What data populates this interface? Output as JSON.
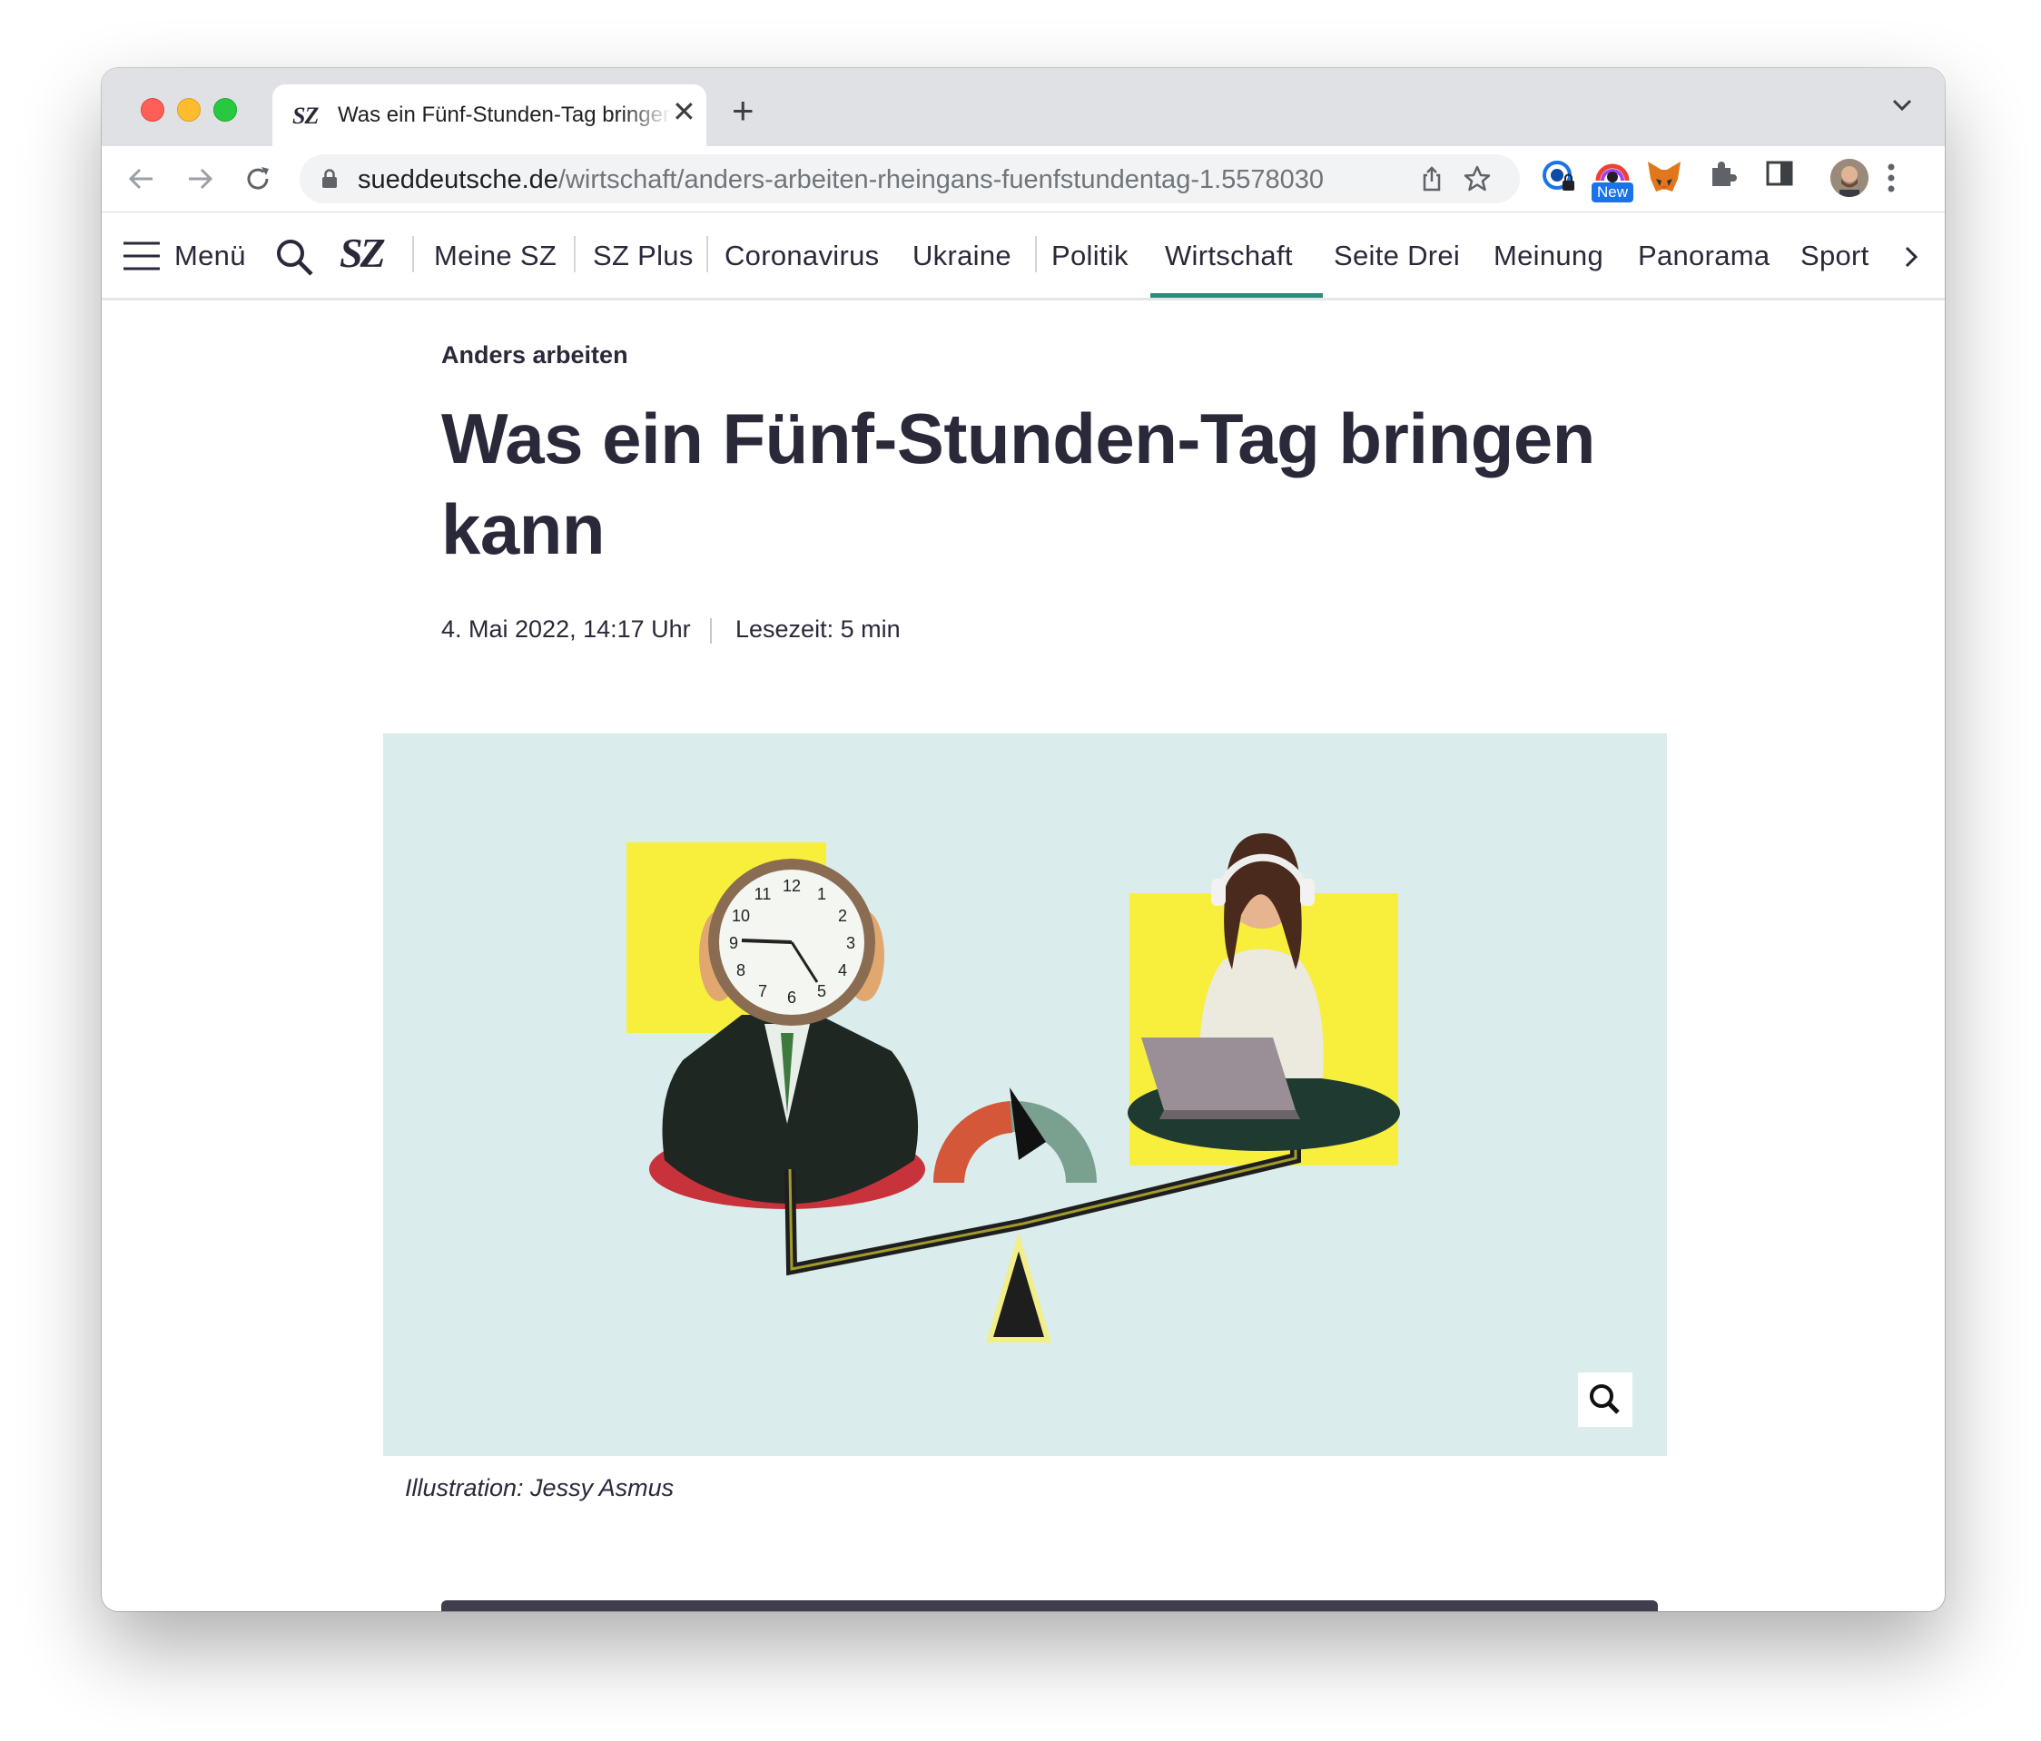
{
  "browser": {
    "tab": {
      "favicon_text": "SZ",
      "title": "Was ein Fünf-Stunden-Tag bringen kann",
      "close_symbol": "✕"
    },
    "new_tab_symbol": "+",
    "url_host": "sueddeutsche.de",
    "url_path": "/wirtschaft/anders-arbeiten-rheingans-fuenfstundentag-1.5578030",
    "extension_badge": "New",
    "icons": [
      "back-icon",
      "forward-icon",
      "reload-icon",
      "lock-icon",
      "share-icon",
      "bookmark-star-icon",
      "password-extension-icon",
      "new-extension-icon",
      "metamask-fox-icon",
      "extensions-puzzle-icon",
      "side-panel-icon",
      "profile-avatar",
      "more-menu-icon",
      "tab-list-chevron-icon"
    ]
  },
  "site_nav": {
    "menu_label": "Menü",
    "logo": "SZ",
    "items": [
      "Meine SZ",
      "SZ Plus",
      "Coronavirus",
      "Ukraine",
      "Politik",
      "Wirtschaft",
      "Seite Drei",
      "Meinung",
      "Panorama",
      "Sport"
    ],
    "active_item": "Wirtschaft",
    "accent_color": "#2e8a7a"
  },
  "article": {
    "kicker": "Anders arbeiten",
    "headline": "Was ein Fünf-Stunden-Tag bringen kann",
    "date": "4. Mai 2022, 14:17 Uhr",
    "reading_time": "Lesezeit: 5 min",
    "image": {
      "caption": "Illustration: Jessy Asmus",
      "background_color": "#dbecec"
    }
  }
}
